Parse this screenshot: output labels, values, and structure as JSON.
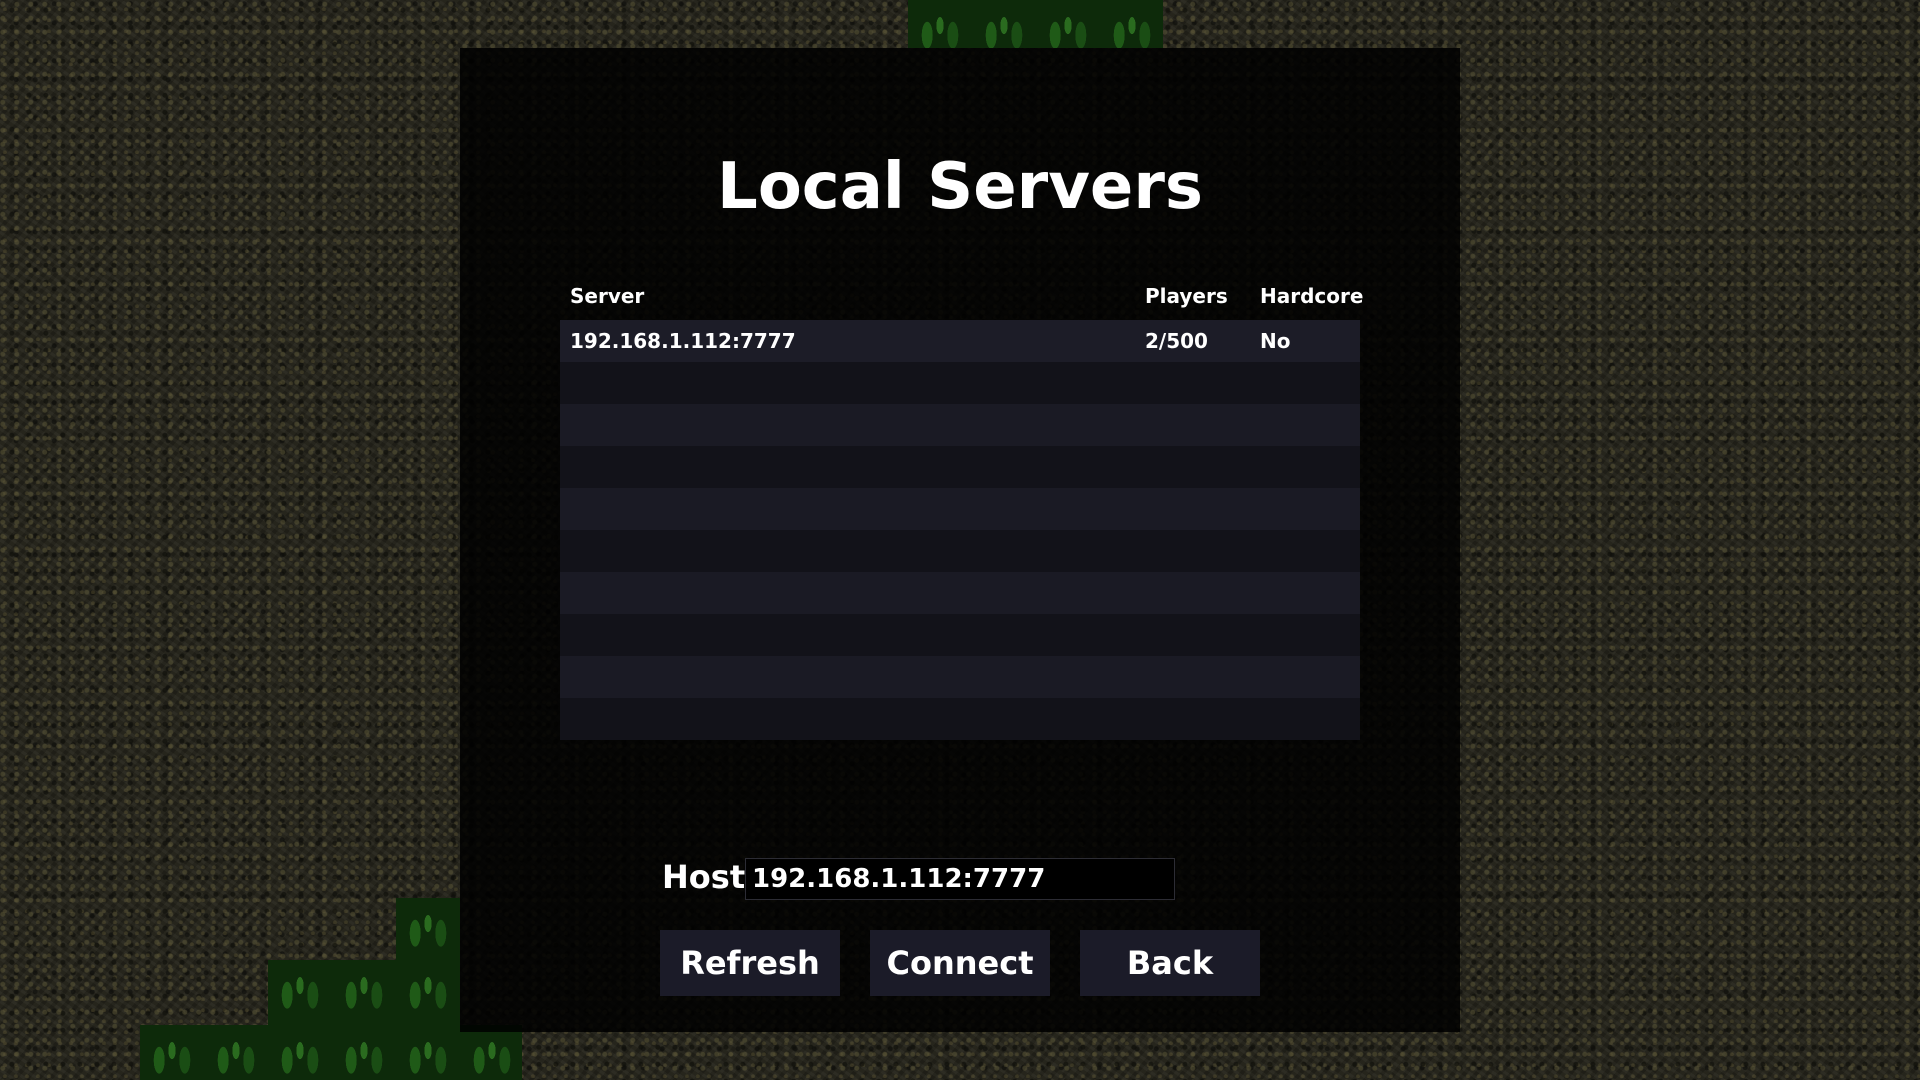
{
  "title": "Local Servers",
  "table": {
    "columns": {
      "server": "Server",
      "players": "Players",
      "hardcore": "Hardcore"
    },
    "rows": [
      {
        "server": "192.168.1.112:7777",
        "players": "2/500",
        "hardcore": "No"
      }
    ]
  },
  "host": {
    "label": "Host",
    "value": "192.168.1.112:7777"
  },
  "buttons": {
    "refresh": "Refresh",
    "connect": "Connect",
    "back": "Back"
  }
}
